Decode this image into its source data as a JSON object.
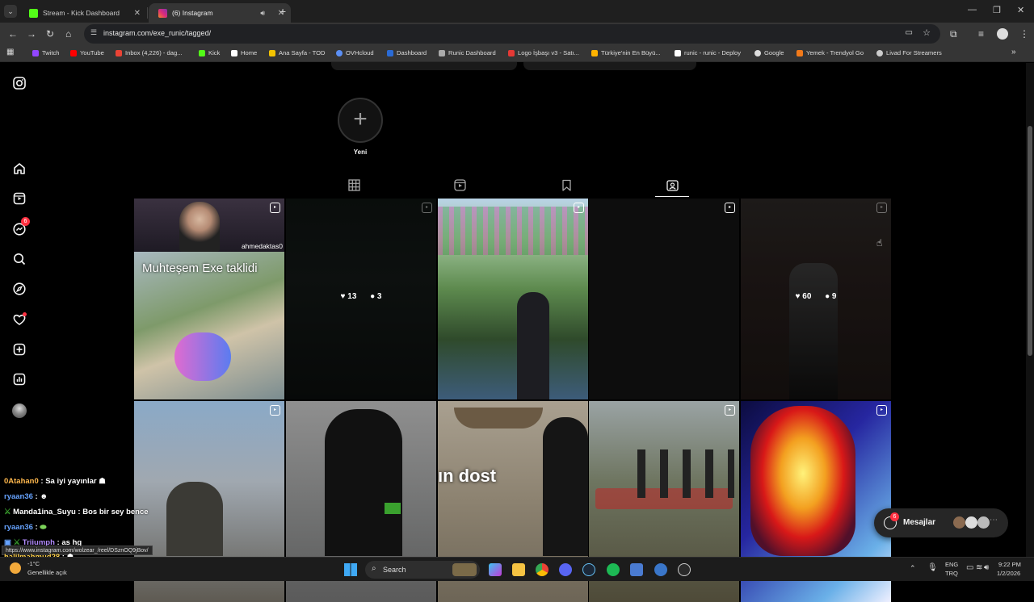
{
  "browser": {
    "tabs": [
      {
        "title": "Stream - Kick Dashboard"
      },
      {
        "title": "(6) Instagram"
      }
    ],
    "url": "instagram.com/exe_runic/tagged/",
    "bookmarks": [
      "Twitch",
      "YouTube",
      "Inbox (4,226) - dag...",
      "Kick",
      "Home",
      "Ana Sayfa - TOD",
      "OVHcloud",
      "Dashboard",
      "Runic Dashboard",
      "Logo İşbaşı v3 - Satı...",
      "Türkiye'nin En Büyü...",
      "runic - runic - Deploy",
      "Google",
      "Yemek - Trendyol Go",
      "Livad For Streamers"
    ],
    "status_url": "https://www.instagram.com/wolzear_/reel/DSznOQ9jBov/"
  },
  "sidebar": {
    "notifications_badge": "6"
  },
  "profile": {
    "new_highlight_label": "Yeni",
    "tabs": [
      "posts-grid",
      "reels",
      "saved",
      "tagged"
    ],
    "active_tab": "tagged"
  },
  "posts": [
    {
      "row": 0,
      "col": 0,
      "overlay_user": "ahmedaktas0",
      "caption": "Muhteşem Exe taklidi",
      "reel": true
    },
    {
      "row": 0,
      "col": 1,
      "likes": "13",
      "comments": "3",
      "reel": true
    },
    {
      "row": 0,
      "col": 2,
      "reel": true
    },
    {
      "row": 0,
      "col": 3,
      "reel": true
    },
    {
      "row": 0,
      "col": 4,
      "likes": "60",
      "comments": "9",
      "reel": true
    },
    {
      "row": 1,
      "col": 0,
      "reel": true
    },
    {
      "row": 1,
      "col": 1
    },
    {
      "row": 1,
      "col": 2,
      "caption": "ın dost"
    },
    {
      "row": 1,
      "col": 3,
      "reel": true
    },
    {
      "row": 1,
      "col": 4,
      "reel": true
    }
  ],
  "chat": [
    {
      "user": "0Atahan0",
      "text": "Sa iyi yayınlar",
      "color": "#ffb84d"
    },
    {
      "user": "ryaan36",
      "text": "",
      "color": "#66a3ff"
    },
    {
      "user": "Manda1ina_Suyu",
      "text": "Bos bir sey bence",
      "color": "#ffffff"
    },
    {
      "user": "ryaan36",
      "text": "",
      "color": "#66a3ff"
    },
    {
      "user": "Triiumph",
      "text": "as hg",
      "color": "#b38cff"
    },
    {
      "user": "halilmahmud28",
      "text": "",
      "color": "#ffd24d"
    }
  ],
  "messages": {
    "label": "Mesajlar",
    "badge": "6"
  },
  "taskbar": {
    "weather_temp": "-1°C",
    "weather_desc": "Genellikle açık",
    "search_placeholder": "Search",
    "lang_top": "ENG",
    "lang_bottom": "TRQ",
    "time": "9:22 PM",
    "date": "1/2/2026"
  },
  "colors": {
    "instagram_badge": "#ff3040",
    "chrome_dark": "#1f1f1f",
    "toolbar": "#353535"
  }
}
